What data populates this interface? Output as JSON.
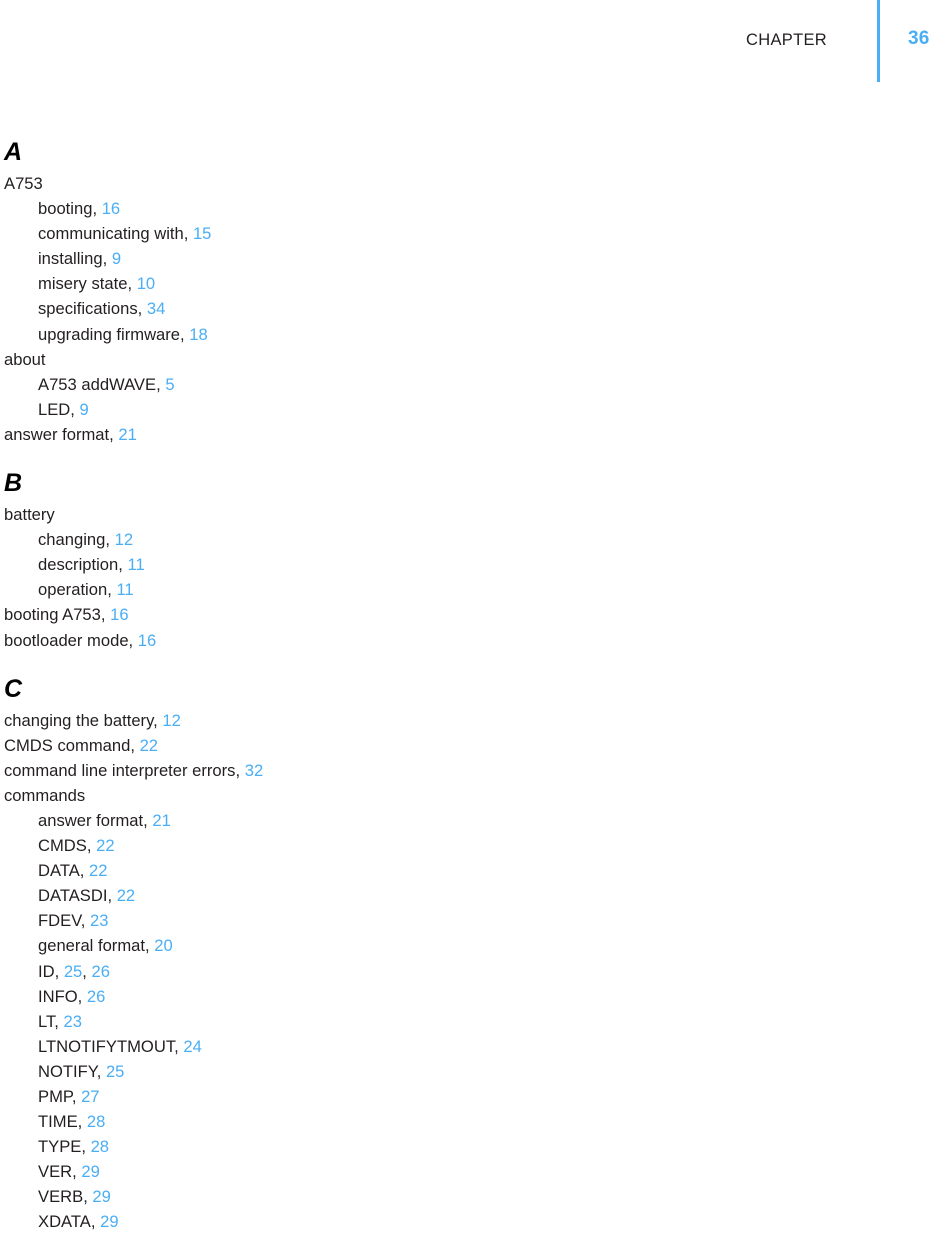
{
  "header": {
    "chapter_label": "CHAPTER",
    "chapter_number": "36",
    "rule_color": "#4aaef5"
  },
  "colors": {
    "page_ref": "#4aaef5",
    "text": "#231f20"
  },
  "index": {
    "sections": [
      {
        "letter": "A",
        "entries": [
          {
            "level": 1,
            "text": "A753",
            "refs": []
          },
          {
            "level": 2,
            "text": "booting",
            "refs": [
              "16"
            ]
          },
          {
            "level": 2,
            "text": "communicating with",
            "refs": [
              "15"
            ]
          },
          {
            "level": 2,
            "text": "installing",
            "refs": [
              "9"
            ]
          },
          {
            "level": 2,
            "text": "misery state",
            "refs": [
              "10"
            ]
          },
          {
            "level": 2,
            "text": "specifications",
            "refs": [
              "34"
            ]
          },
          {
            "level": 2,
            "text": "upgrading firmware",
            "refs": [
              "18"
            ]
          },
          {
            "level": 1,
            "text": "about",
            "refs": []
          },
          {
            "level": 2,
            "text": "A753 addWAVE",
            "refs": [
              "5"
            ]
          },
          {
            "level": 2,
            "text": "LED",
            "refs": [
              "9"
            ]
          },
          {
            "level": 1,
            "text": "answer format",
            "refs": [
              "21"
            ]
          }
        ]
      },
      {
        "letter": "B",
        "entries": [
          {
            "level": 1,
            "text": "battery",
            "refs": []
          },
          {
            "level": 2,
            "text": "changing",
            "refs": [
              "12"
            ]
          },
          {
            "level": 2,
            "text": "description",
            "refs": [
              "11"
            ]
          },
          {
            "level": 2,
            "text": "operation",
            "refs": [
              "11"
            ]
          },
          {
            "level": 1,
            "text": "booting A753",
            "refs": [
              "16"
            ]
          },
          {
            "level": 1,
            "text": "bootloader mode",
            "refs": [
              "16"
            ]
          }
        ]
      },
      {
        "letter": "C",
        "entries": [
          {
            "level": 1,
            "text": "changing the battery",
            "refs": [
              "12"
            ]
          },
          {
            "level": 1,
            "text": "CMDS command",
            "refs": [
              "22"
            ]
          },
          {
            "level": 1,
            "text": "command line interpreter errors",
            "refs": [
              "32"
            ]
          },
          {
            "level": 1,
            "text": "commands",
            "refs": []
          },
          {
            "level": 2,
            "text": "answer format",
            "refs": [
              "21"
            ]
          },
          {
            "level": 2,
            "text": "CMDS",
            "refs": [
              "22"
            ]
          },
          {
            "level": 2,
            "text": "DATA",
            "refs": [
              "22"
            ]
          },
          {
            "level": 2,
            "text": "DATASDI",
            "refs": [
              "22"
            ]
          },
          {
            "level": 2,
            "text": "FDEV",
            "refs": [
              "23"
            ]
          },
          {
            "level": 2,
            "text": "general format",
            "refs": [
              "20"
            ]
          },
          {
            "level": 2,
            "text": "ID",
            "refs": [
              "25",
              "26"
            ]
          },
          {
            "level": 2,
            "text": "INFO",
            "refs": [
              "26"
            ]
          },
          {
            "level": 2,
            "text": "LT",
            "refs": [
              "23"
            ]
          },
          {
            "level": 2,
            "text": "LTNOTIFYTMOUT",
            "refs": [
              "24"
            ]
          },
          {
            "level": 2,
            "text": "NOTIFY",
            "refs": [
              "25"
            ]
          },
          {
            "level": 2,
            "text": "PMP",
            "refs": [
              "27"
            ]
          },
          {
            "level": 2,
            "text": "TIME",
            "refs": [
              "28"
            ]
          },
          {
            "level": 2,
            "text": "TYPE",
            "refs": [
              "28"
            ]
          },
          {
            "level": 2,
            "text": "VER",
            "refs": [
              "29"
            ]
          },
          {
            "level": 2,
            "text": "VERB",
            "refs": [
              "29"
            ]
          },
          {
            "level": 2,
            "text": "XDATA",
            "refs": [
              "29"
            ]
          }
        ]
      }
    ]
  }
}
